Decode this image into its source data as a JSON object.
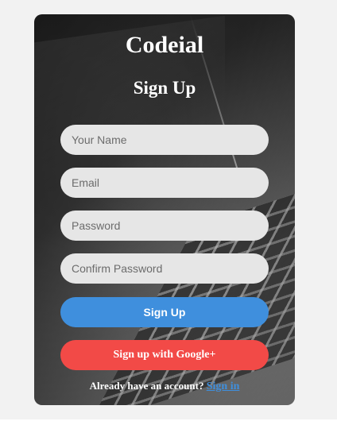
{
  "brand": {
    "name": "Codeial"
  },
  "form": {
    "title": "Sign Up",
    "fields": {
      "name": {
        "placeholder": "Your Name",
        "value": ""
      },
      "email": {
        "placeholder": "Email",
        "value": ""
      },
      "password": {
        "placeholder": "Password",
        "value": ""
      },
      "confirm_password": {
        "placeholder": "Confirm Password",
        "value": ""
      }
    },
    "submit_label": "Sign Up",
    "google_label": "Sign up with Google+",
    "footer_text": "Already have an account?",
    "signin_link": "Sign in"
  },
  "colors": {
    "primary_button": "#3f8fdd",
    "google_button": "#f24a47",
    "input_bg": "#e6e6e6",
    "link": "#3f8fdd"
  }
}
